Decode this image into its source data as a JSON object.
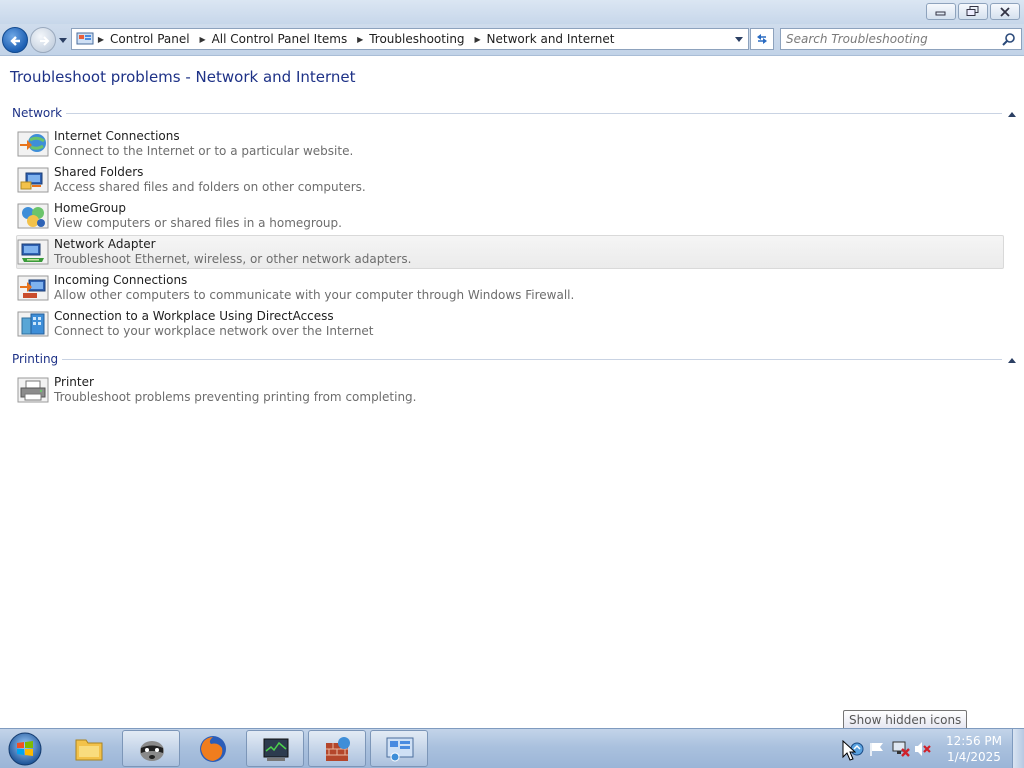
{
  "window": {
    "buttons": [
      "minimize",
      "maximize",
      "close"
    ]
  },
  "navbar": {
    "breadcrumbs": [
      "Control Panel",
      "All Control Panel Items",
      "Troubleshooting",
      "Network and Internet"
    ],
    "search_placeholder": "Search Troubleshooting"
  },
  "page": {
    "title": "Troubleshoot problems - Network and Internet"
  },
  "sections": [
    {
      "label": "Network",
      "items": [
        {
          "title": "Internet Connections",
          "desc": "Connect to the Internet or to a particular website.",
          "icon": "internet-connections-icon"
        },
        {
          "title": "Shared Folders",
          "desc": "Access shared files and folders on other computers.",
          "icon": "shared-folders-icon"
        },
        {
          "title": "HomeGroup",
          "desc": "View computers or shared files in a homegroup.",
          "icon": "homegroup-icon"
        },
        {
          "title": "Network Adapter",
          "desc": "Troubleshoot Ethernet, wireless, or other network adapters.",
          "icon": "network-adapter-icon",
          "highlighted": true
        },
        {
          "title": "Incoming Connections",
          "desc": "Allow other computers to communicate with your computer through Windows Firewall.",
          "icon": "incoming-connections-icon"
        },
        {
          "title": "Connection to a Workplace Using DirectAccess",
          "desc": "Connect to your workplace network over the Internet",
          "icon": "directaccess-icon"
        }
      ]
    },
    {
      "label": "Printing",
      "items": [
        {
          "title": "Printer",
          "desc": "Troubleshoot problems preventing printing from completing.",
          "icon": "printer-icon"
        }
      ]
    }
  ],
  "tooltip": {
    "text": "Show hidden icons"
  },
  "taskbar": {
    "items": [
      "windows-explorer-icon",
      "raccoon-app-icon",
      "firefox-icon",
      "task-manager-icon",
      "firewall-icon",
      "control-panel-icon"
    ],
    "tray_icons": [
      "show-hidden-icons-icon",
      "action-center-flag-icon",
      "network-disconnected-icon",
      "volume-muted-icon"
    ],
    "clock": {
      "time": "12:56 PM",
      "date": "1/4/2025"
    }
  },
  "colors": {
    "heading": "#1e3287",
    "muted_text": "#6d6d6d",
    "taskbar": "#aac1de"
  }
}
